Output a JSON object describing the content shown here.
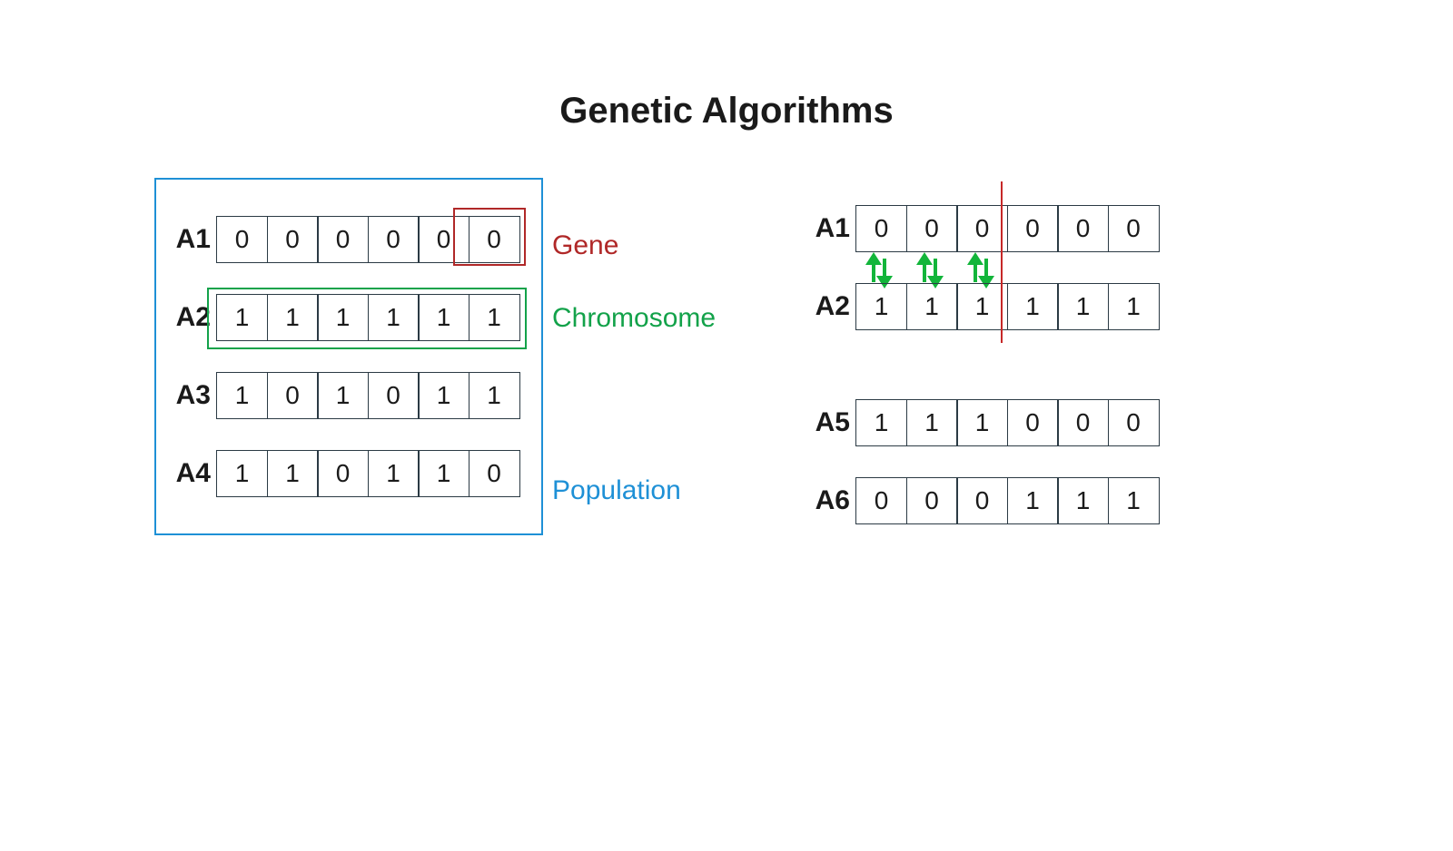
{
  "title": "Genetic Algorithms",
  "labels": {
    "gene": "Gene",
    "chromosome": "Chromosome",
    "population": "Population"
  },
  "left": {
    "A1": {
      "label": "A1",
      "cells": [
        "0",
        "0",
        "0",
        "0",
        "0",
        "0"
      ]
    },
    "A2": {
      "label": "A2",
      "cells": [
        "1",
        "1",
        "1",
        "1",
        "1",
        "1"
      ]
    },
    "A3": {
      "label": "A3",
      "cells": [
        "1",
        "0",
        "1",
        "0",
        "1",
        "1"
      ]
    },
    "A4": {
      "label": "A4",
      "cells": [
        "1",
        "1",
        "0",
        "1",
        "1",
        "0"
      ]
    }
  },
  "right": {
    "A1": {
      "label": "A1",
      "cells": [
        "0",
        "0",
        "0",
        "0",
        "0",
        "0"
      ]
    },
    "A2": {
      "label": "A2",
      "cells": [
        "1",
        "1",
        "1",
        "1",
        "1",
        "1"
      ]
    },
    "A5": {
      "label": "A5",
      "cells": [
        "1",
        "1",
        "1",
        "0",
        "0",
        "0"
      ]
    },
    "A6": {
      "label": "A6",
      "cells": [
        "0",
        "0",
        "0",
        "1",
        "1",
        "1"
      ]
    }
  },
  "chart_data": {
    "type": "table",
    "description": "Genetic algorithm concepts: a population of 4 chromosomes (A1–A4), each a 6-bit string. A single bit is a gene. Right side shows one-point crossover between A1 and A2 at position 3 (swap first 3 genes), producing offspring A5 and A6.",
    "population": [
      {
        "id": "A1",
        "genes": [
          0,
          0,
          0,
          0,
          0,
          0
        ]
      },
      {
        "id": "A2",
        "genes": [
          1,
          1,
          1,
          1,
          1,
          1
        ]
      },
      {
        "id": "A3",
        "genes": [
          1,
          0,
          1,
          0,
          1,
          1
        ]
      },
      {
        "id": "A4",
        "genes": [
          1,
          1,
          0,
          1,
          1,
          0
        ]
      }
    ],
    "gene_highlight": {
      "chromosome": "A1",
      "index": 5
    },
    "chromosome_highlight": "A2",
    "crossover": {
      "parents": [
        "A1",
        "A2"
      ],
      "cut_index": 3,
      "offspring": [
        {
          "id": "A5",
          "genes": [
            1,
            1,
            1,
            0,
            0,
            0
          ]
        },
        {
          "id": "A6",
          "genes": [
            0,
            0,
            0,
            1,
            1,
            1
          ]
        }
      ]
    }
  }
}
